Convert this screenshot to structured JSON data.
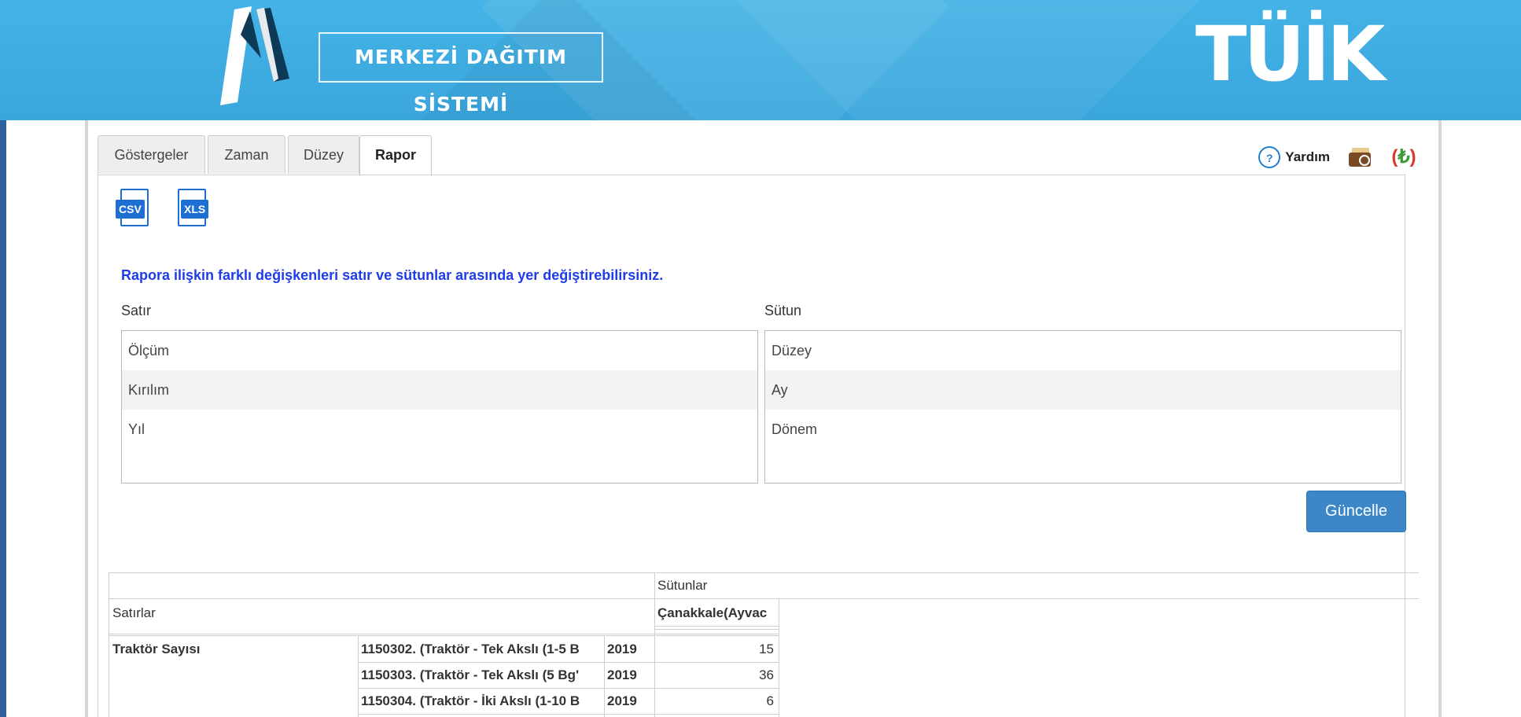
{
  "header": {
    "brand_title": "MERKEZİ DAĞITIM SİSTEMİ",
    "org_logo": "TÜİK"
  },
  "tabs": [
    {
      "label": "Göstergeler",
      "active": false
    },
    {
      "label": "Zaman",
      "active": false
    },
    {
      "label": "Düzey",
      "active": false
    },
    {
      "label": "Rapor",
      "active": true
    }
  ],
  "tools": {
    "help_label": "Yardım",
    "help_icon": "help-bubble-icon",
    "wallet_icon": "wallet-search-icon",
    "currency_icon": "lira-icon"
  },
  "export": {
    "csv_badge": "CSV",
    "xls_badge": "XLS"
  },
  "pivot": {
    "info": "Rapora ilişkin farklı değişkenleri satır ve sütunlar arasında yer değiştirebilirsiniz.",
    "row_label": "Satır",
    "column_label": "Sütun",
    "row_items": [
      "Ölçüm",
      "Kırılım",
      "Yıl"
    ],
    "column_items": [
      "Düzey",
      "Ay",
      "Dönem"
    ],
    "update_button": "Güncelle"
  },
  "report": {
    "columns_header": "Sütunlar",
    "rows_header": "Satırlar",
    "column_value": "Çanakkale(Ayvac",
    "measure": "Traktör Sayısı",
    "rows": [
      {
        "breakdown": "1150302. (Traktör - Tek Akslı (1-5 B",
        "year": "2019",
        "value": "15"
      },
      {
        "breakdown": "1150303. (Traktör - Tek Akslı (5 Bg'",
        "year": "2019",
        "value": "36"
      },
      {
        "breakdown": "1150304. (Traktör - İki Akslı (1-10 B",
        "year": "2019",
        "value": "6"
      }
    ]
  },
  "colors": {
    "header_blue": "#3aa6dd",
    "link_blue": "#1e3ce8",
    "button_blue": "#3d87c9",
    "icon_blue": "#1e6fd4"
  }
}
